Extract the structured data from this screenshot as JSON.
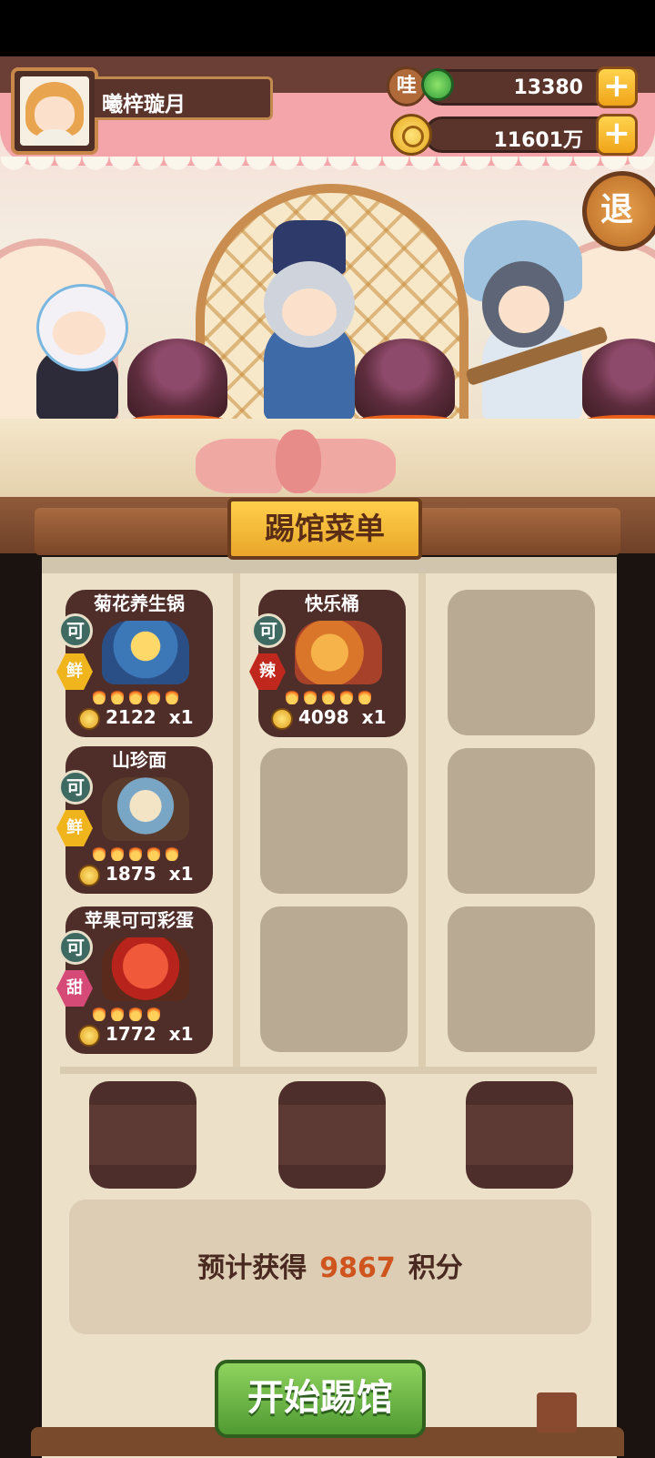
{
  "player": {
    "name": "曦梓璇月"
  },
  "currency": {
    "jade_badge": "哇",
    "jade_value": "13380",
    "gold_value": "11601万",
    "plus_label": "+"
  },
  "exit_label": "退",
  "menu": {
    "title": "踢馆菜单",
    "dishes": [
      {
        "name": "菊花养生锅",
        "ok": "可",
        "flavor": "鲜",
        "flavor_color": "#f0b41c",
        "price": "2122",
        "qty": "x1",
        "flames": 5
      },
      {
        "name": "快乐桶",
        "ok": "可",
        "flavor": "辣",
        "flavor_color": "#c0281e",
        "price": "4098",
        "qty": "x1",
        "flames": 5
      },
      {
        "name": "山珍面",
        "ok": "可",
        "flavor": "鲜",
        "flavor_color": "#f0b41c",
        "price": "1875",
        "qty": "x1",
        "flames": 5
      },
      {
        "name": "苹果可可彩蛋",
        "ok": "可",
        "flavor": "甜",
        "flavor_color": "#d64a78",
        "price": "1772",
        "qty": "x1",
        "flames": 4
      }
    ]
  },
  "score": {
    "prefix": "预计获得",
    "value": "9867",
    "suffix": "积分"
  },
  "start_button": "开始踢馆"
}
